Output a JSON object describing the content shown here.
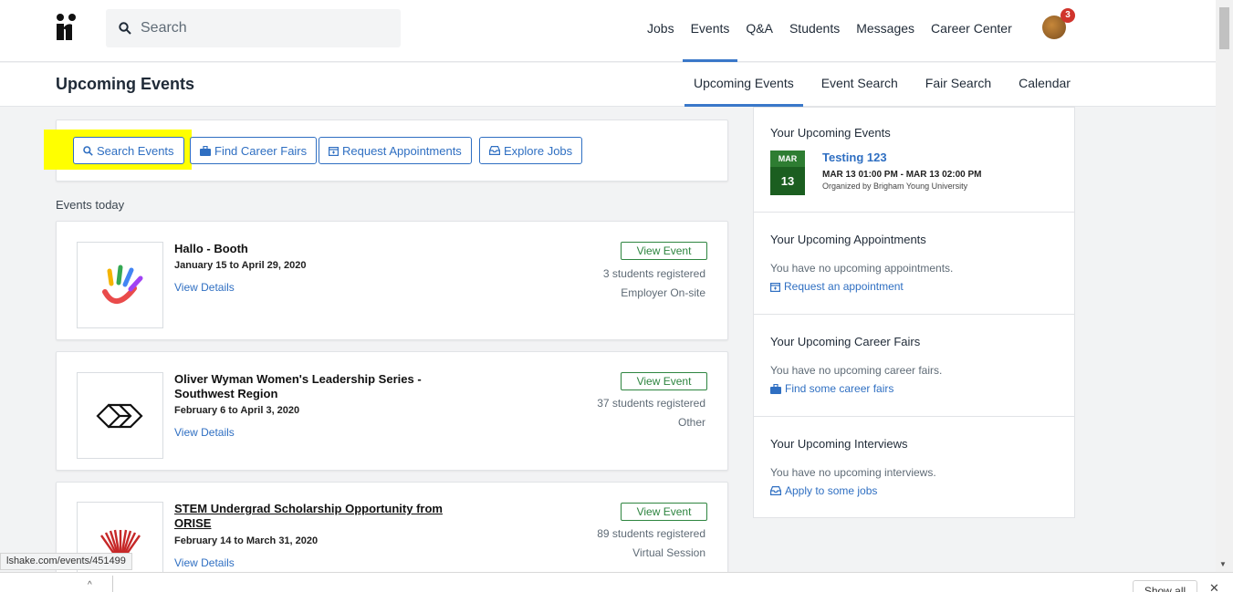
{
  "search": {
    "placeholder": "Search"
  },
  "nav": [
    "Jobs",
    "Events",
    "Q&A",
    "Students",
    "Messages",
    "Career Center"
  ],
  "notifications": {
    "count": "3"
  },
  "page": {
    "title": "Upcoming Events"
  },
  "subnav": [
    "Upcoming Events",
    "Event Search",
    "Fair Search",
    "Calendar"
  ],
  "actions": {
    "search_events": "Search Events",
    "find_career_fairs": "Find Career Fairs",
    "request_appointments": "Request Appointments",
    "explore_jobs": "Explore Jobs"
  },
  "events_today_label": "Events today",
  "events": [
    {
      "title": "Hallo - Booth",
      "dates": "January 15 to April 29, 2020",
      "details": "View Details",
      "button": "View Event",
      "registered": "3 students registered",
      "type": "Employer On-site"
    },
    {
      "title": "Oliver Wyman Women's Leadership Series - Southwest Region",
      "dates": "February 6 to April 3, 2020",
      "details": "View Details",
      "button": "View Event",
      "registered": "37 students registered",
      "type": "Other"
    },
    {
      "title": "STEM Undergrad Scholarship Opportunity from ORISE",
      "dates": "February 14 to March 31, 2020",
      "details": "View Details",
      "button": "View Event",
      "registered": "89 students registered",
      "type": "Virtual Session"
    }
  ],
  "sidebar": {
    "upcoming_events": {
      "heading": "Your Upcoming Events",
      "month": "MAR",
      "day": "13",
      "title": "Testing 123",
      "time": "MAR 13 01:00 PM - MAR 13 02:00 PM",
      "organizer": "Organized by Brigham Young University"
    },
    "appointments": {
      "heading": "Your Upcoming Appointments",
      "empty": "You have no upcoming appointments.",
      "link": "Request an appointment"
    },
    "fairs": {
      "heading": "Your Upcoming Career Fairs",
      "empty": "You have no upcoming career fairs.",
      "link": "Find some career fairs"
    },
    "interviews": {
      "heading": "Your Upcoming Interviews",
      "empty": "You have no upcoming interviews.",
      "link": "Apply to some jobs"
    }
  },
  "status_url": "lshake.com/events/451499",
  "downloads": {
    "show_all": "Show all"
  },
  "colors": {
    "accent": "#2f6fc2",
    "green": "#2e8540",
    "highlight": "#ffff00",
    "badge": "#d0342c"
  }
}
